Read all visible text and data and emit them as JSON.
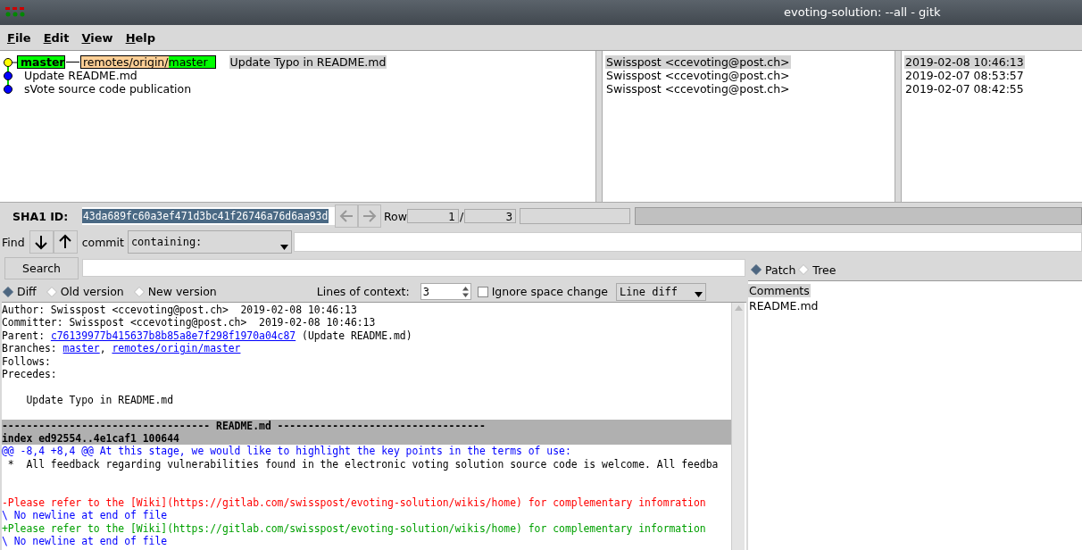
{
  "window": {
    "title": "evoting-solution: --all - gitk"
  },
  "menu": [
    {
      "label": "File"
    },
    {
      "label": "Edit"
    },
    {
      "label": "View"
    },
    {
      "label": "Help"
    }
  ],
  "commits": [
    {
      "color": "#ffff00",
      "selected": true,
      "refs": [
        {
          "kind": "local",
          "name": "master"
        },
        {
          "kind": "remote",
          "prefix": "remotes/origin/",
          "name": "master"
        }
      ],
      "headline": "Update Typo in README.md",
      "author": "Swisspost <ccevoting@post.ch>",
      "date": "2019-02-08 10:46:13"
    },
    {
      "color": "#0000ff",
      "selected": false,
      "headline": "Update README.md",
      "author": "Swisspost <ccevoting@post.ch>",
      "date": "2019-02-07 08:53:57"
    },
    {
      "color": "#0000ff",
      "selected": false,
      "headline": "sVote source code publication",
      "author": "Swisspost <ccevoting@post.ch>",
      "date": "2019-02-07 08:42:55"
    }
  ],
  "sha1": {
    "label": "SHA1 ID:",
    "value": "43da689fc60a3ef471d3bc41f26746a76d6aa93d"
  },
  "row": {
    "label": "Row",
    "current": "1",
    "separator": "/",
    "total": "3"
  },
  "progress": {
    "level": 0
  },
  "find": {
    "label": "Find",
    "type": "commit",
    "mode": "containing:"
  },
  "search_button": "Search",
  "diff_options": [
    {
      "label": "Diff",
      "selected": true
    },
    {
      "label": "Old version",
      "selected": false
    },
    {
      "label": "New version",
      "selected": false
    }
  ],
  "context": {
    "label": "Lines of context:",
    "value": "3"
  },
  "ignore_space": {
    "label": "Ignore space change",
    "checked": false
  },
  "diff_mode": "Line diff",
  "diff_lines": [
    {
      "kind": "meta",
      "parts": [
        {
          "text": "Author: Swisspost <ccevoting@post.ch>  2019-02-08 10:46:13",
          "link": false
        }
      ]
    },
    {
      "kind": "meta",
      "parts": [
        {
          "text": "Committer: Swisspost <ccevoting@post.ch>  2019-02-08 10:46:13",
          "link": false
        }
      ]
    },
    {
      "kind": "meta",
      "parts": [
        {
          "text": "Parent: ",
          "link": false
        },
        {
          "text": "c76139977b415637b8b85a8e7f298f1970a04c87",
          "link": true
        },
        {
          "text": " (Update README.md)",
          "link": false
        }
      ]
    },
    {
      "kind": "meta",
      "parts": [
        {
          "text": "Branches: ",
          "link": false
        },
        {
          "text": "master",
          "link": true
        },
        {
          "text": ", ",
          "link": false
        },
        {
          "text": "remotes/origin/master",
          "link": true
        }
      ]
    },
    {
      "kind": "meta",
      "parts": [
        {
          "text": "Follows:",
          "link": false
        }
      ]
    },
    {
      "kind": "meta",
      "parts": [
        {
          "text": "Precedes:",
          "link": false
        }
      ]
    },
    {
      "kind": "blank"
    },
    {
      "kind": "message",
      "text": "    Update Typo in README.md"
    },
    {
      "kind": "blank"
    },
    {
      "kind": "file",
      "text": "---------------------------------- README.md ----------------------------------"
    },
    {
      "kind": "index",
      "text": "index ed92554..4e1caf1 100644"
    },
    {
      "kind": "hunk",
      "text": "@@ -8,4 +8,4 @@ At this stage, we would like to highlight the key points in the terms of use:"
    },
    {
      "kind": "context",
      "text": " *  All feedback regarding vulnerabilities found in the electronic voting solution source code is welcome. All feedba"
    },
    {
      "kind": "blank"
    },
    {
      "kind": "blank"
    },
    {
      "kind": "removed",
      "text": "-Please refer to the [Wiki](https://gitlab.com/swisspost/evoting-solution/wikis/home) for complementary infomration"
    },
    {
      "kind": "nonewline",
      "text": "\\ No newline at end of file"
    },
    {
      "kind": "added",
      "text": "+Please refer to the [Wiki](https://gitlab.com/swisspost/evoting-solution/wikis/home) for complementary information"
    },
    {
      "kind": "nonewline",
      "text": "\\ No newline at end of file"
    }
  ],
  "view_modes": [
    {
      "label": "Patch",
      "selected": true
    },
    {
      "label": "Tree",
      "selected": false
    }
  ],
  "files": [
    {
      "name": "Comments",
      "selected": true
    },
    {
      "name": "README.md",
      "selected": false
    }
  ]
}
